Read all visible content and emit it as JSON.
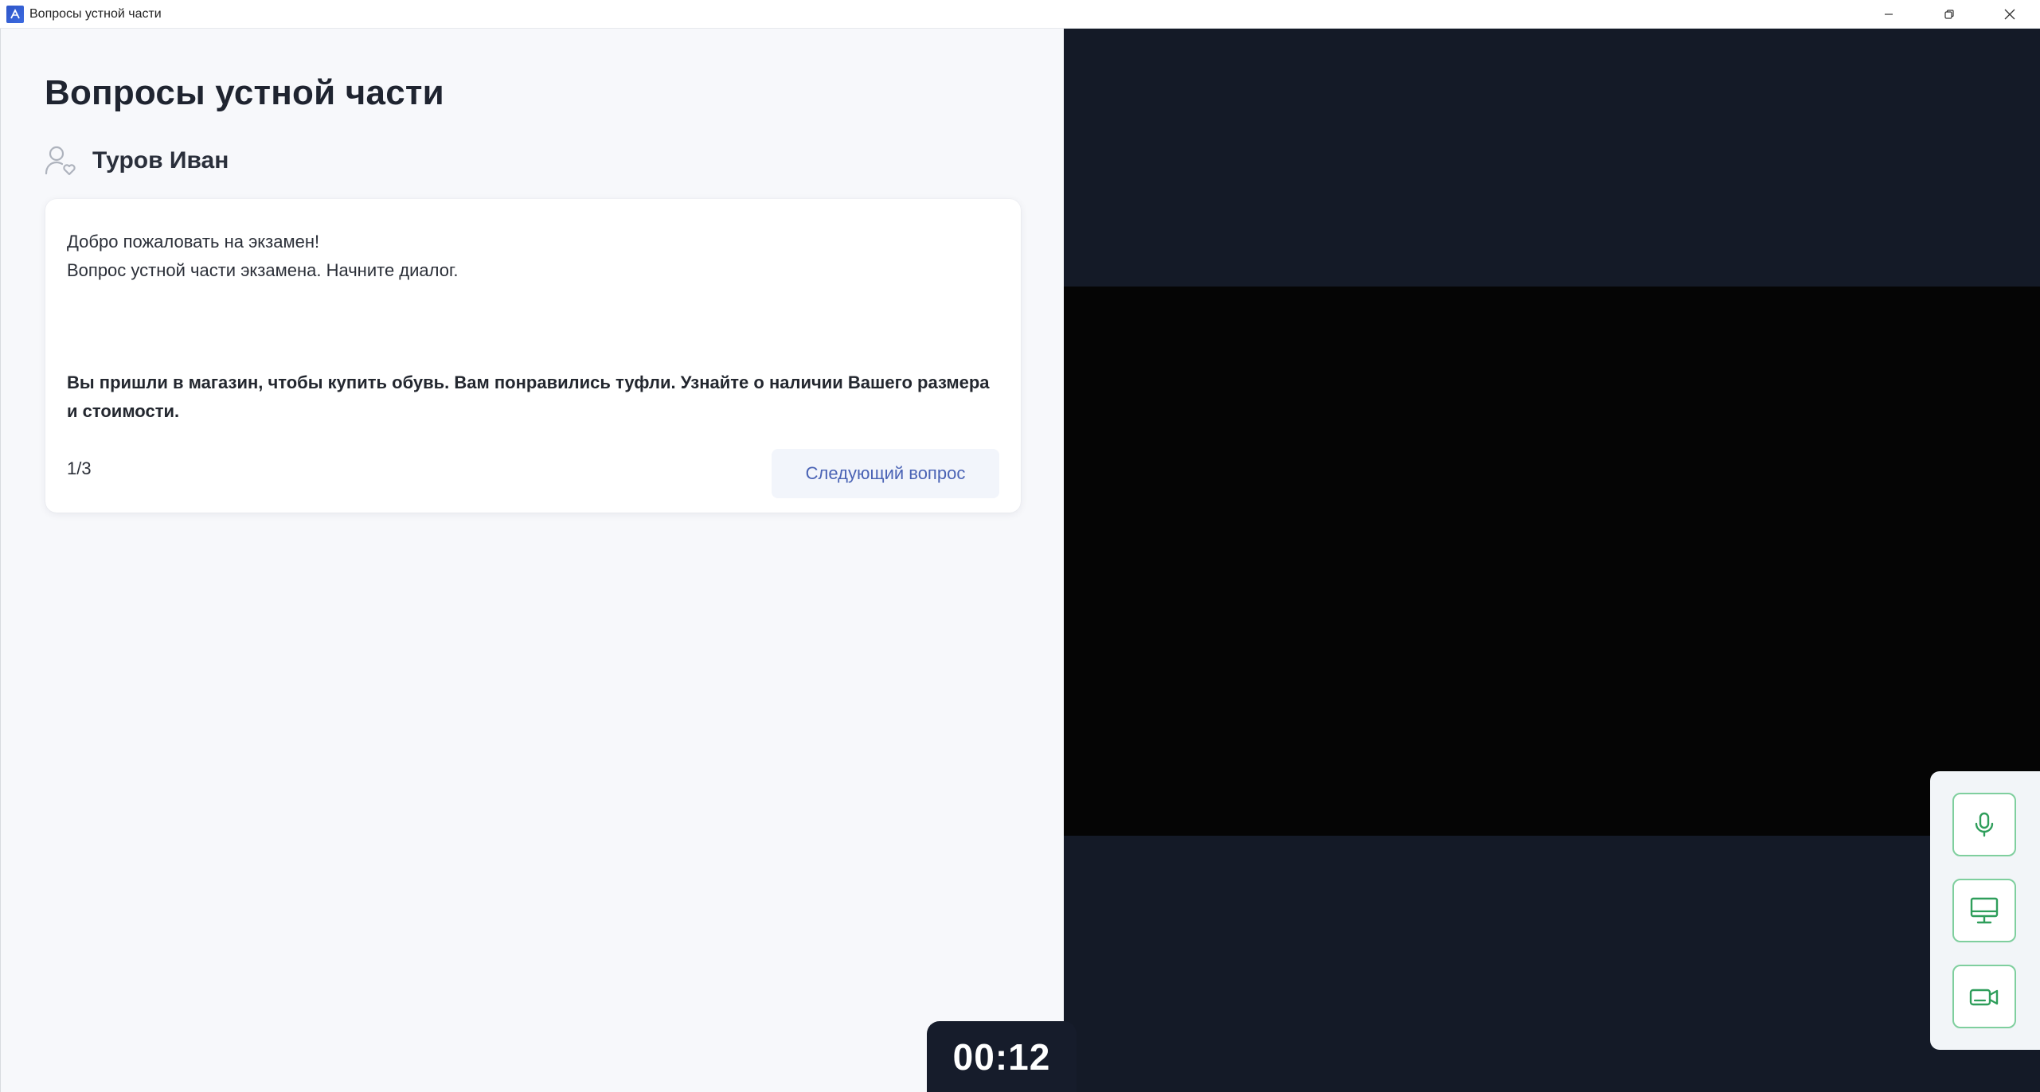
{
  "window": {
    "title": "Вопросы устной части",
    "icon": "app-logo-icon"
  },
  "page": {
    "title": "Вопросы устной части"
  },
  "user": {
    "icon": "user-heart-icon",
    "name": "Туров Иван"
  },
  "card": {
    "greeting_line1": "Добро пожаловать на экзамен!",
    "greeting_line2": "Вопрос устной части экзамена. Начните диалог.",
    "task_text": "Вы пришли в магазин, чтобы купить обувь. Вам понравились туфли. Узнайте о наличии Вашего размера и стоимости.",
    "counter": "1/3",
    "next_button_label": "Следующий вопрос"
  },
  "media_controls": {
    "items": [
      {
        "icon": "microphone-icon"
      },
      {
        "icon": "monitor-icon"
      },
      {
        "icon": "video-camera-icon"
      }
    ],
    "accent_color": "#2f9e5b"
  },
  "timer": {
    "value": "00:12"
  },
  "colors": {
    "left_bg": "#f7f8fb",
    "video_bg": "#141a27",
    "button_text": "#4a63b5"
  }
}
